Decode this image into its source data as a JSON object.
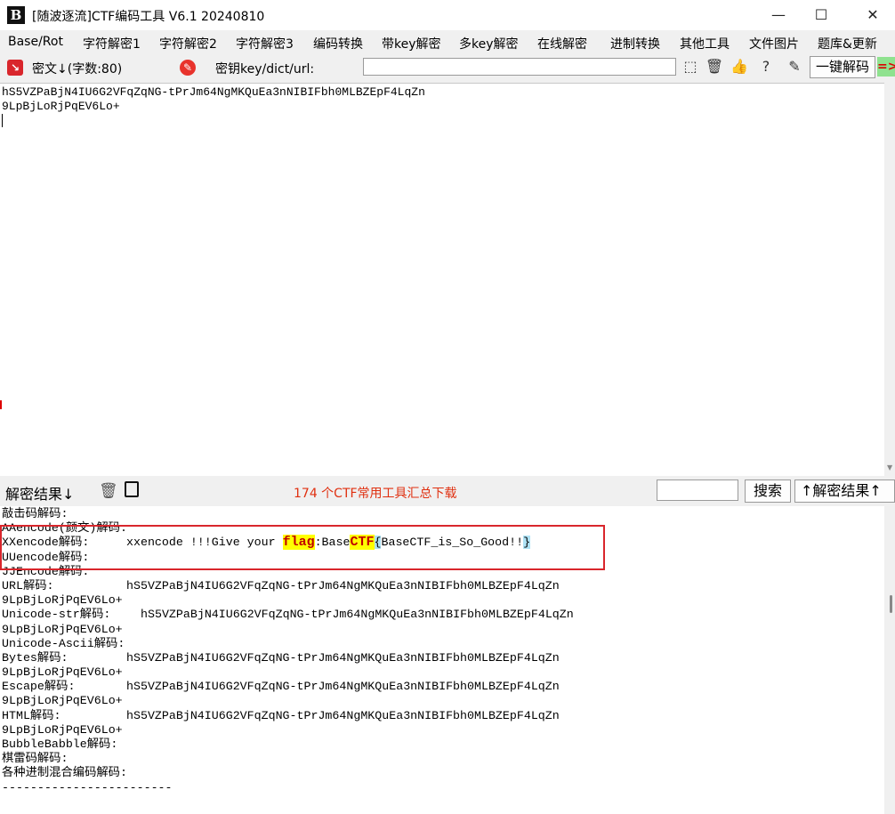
{
  "window": {
    "title": "[随波逐流]CTF编码工具 V6.1 20240810",
    "logo": "B",
    "minimize": "—",
    "maximize": "☐",
    "close": "✕"
  },
  "menu": [
    "Base/Rot",
    "字符解密1",
    "字符解密2",
    "字符解密3",
    "编码转换",
    "带key解密",
    "多key解密",
    "在线解密",
    "进制转换",
    "其他工具",
    "文件图片",
    "题库&更新"
  ],
  "toolbar": {
    "cipher_label": "密文↓(字数:80)",
    "key_label": "密钥key/dict/url:",
    "key_value": "",
    "one_click_decode": "一键解码",
    "accent_red": "#d9262c",
    "accent_green": "#22aa22"
  },
  "cipher_text": {
    "line1": "hS5VZPaBjN4IU6G2VFqZqNG-tPrJm64NgMKQuEa3nNIBIFbh0MLBZEpF4LqZn",
    "line2": "9LpBjLoRjPqEV6Lo+"
  },
  "result_bar": {
    "label": "解密结果↓",
    "banner": "174 个CTF常用工具汇总下载",
    "search_value": "",
    "search_button": "搜索",
    "result_up": "↑解密结果↑"
  },
  "results": [
    {
      "label": "敲击码解码:",
      "value": ""
    },
    {
      "label": "AAencode(颜文)解码:",
      "value": ""
    },
    {
      "label": "XXencode解码:",
      "value": "",
      "special": true
    },
    {
      "label": "UUencode解码:",
      "value": ""
    },
    {
      "label": "JJEncode解码:",
      "value": ""
    },
    {
      "label": "URL解码:",
      "value": "hS5VZPaBjN4IU6G2VFqZqNG-tPrJm64NgMKQuEa3nNIBIFbh0MLBZEpF4LqZn"
    },
    {
      "label": "9LpBjLoRjPqEV6Lo+",
      "value": ""
    },
    {
      "label": "Unicode-str解码:",
      "value": "hS5VZPaBjN4IU6G2VFqZqNG-tPrJm64NgMKQuEa3nNIBIFbh0MLBZEpF4LqZn",
      "shift": true
    },
    {
      "label": "9LpBjLoRjPqEV6Lo+",
      "value": ""
    },
    {
      "label": "Unicode-Ascii解码:",
      "value": ""
    },
    {
      "label": "Bytes解码:",
      "value": "hS5VZPaBjN4IU6G2VFqZqNG-tPrJm64NgMKQuEa3nNIBIFbh0MLBZEpF4LqZn"
    },
    {
      "label": "9LpBjLoRjPqEV6Lo+",
      "value": ""
    },
    {
      "label": "Escape解码:",
      "value": "hS5VZPaBjN4IU6G2VFqZqNG-tPrJm64NgMKQuEa3nNIBIFbh0MLBZEpF4LqZn"
    },
    {
      "label": "9LpBjLoRjPqEV6Lo+",
      "value": ""
    },
    {
      "label": "HTML解码:",
      "value": "hS5VZPaBjN4IU6G2VFqZqNG-tPrJm64NgMKQuEa3nNIBIFbh0MLBZEpF4LqZn"
    },
    {
      "label": "9LpBjLoRjPqEV6Lo+",
      "value": ""
    },
    {
      "label": "BubbleBabble解码:",
      "value": ""
    },
    {
      "label": "棋雷码解码:",
      "value": ""
    },
    {
      "label": "各种进制混合编码解码:",
      "value": ""
    },
    {
      "label": "------------------------",
      "value": ""
    }
  ],
  "xxencode": {
    "prefix": "xxencode !!!Give your ",
    "flag": "flag",
    "mid": ":Base",
    "ctf": "CTF",
    "brace_open": "{",
    "inner": "BaseCTF_is_So_Good!!",
    "brace_close": "}"
  }
}
